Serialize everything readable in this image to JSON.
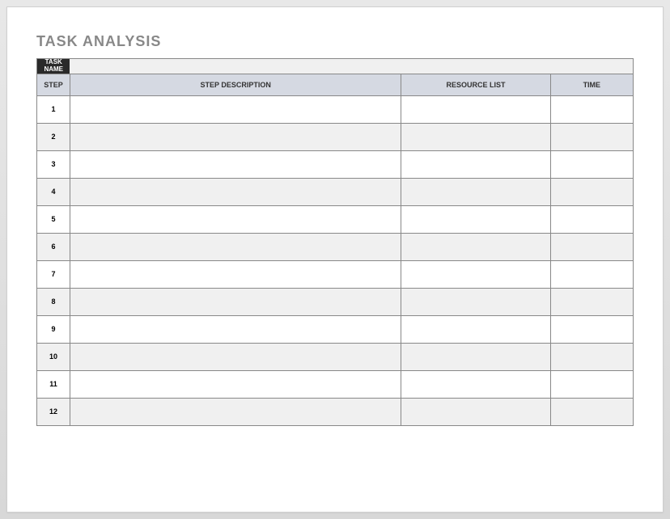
{
  "title": "TASK ANALYSIS",
  "taskNameLine1": "TASK",
  "taskNameLine2": "NAME",
  "headers": {
    "step": "STEP",
    "description": "STEP DESCRIPTION",
    "resource": "RESOURCE LIST",
    "time": "TIME"
  },
  "rows": [
    {
      "step": "1",
      "description": "",
      "resource": "",
      "time": ""
    },
    {
      "step": "2",
      "description": "",
      "resource": "",
      "time": ""
    },
    {
      "step": "3",
      "description": "",
      "resource": "",
      "time": ""
    },
    {
      "step": "4",
      "description": "",
      "resource": "",
      "time": ""
    },
    {
      "step": "5",
      "description": "",
      "resource": "",
      "time": ""
    },
    {
      "step": "6",
      "description": "",
      "resource": "",
      "time": ""
    },
    {
      "step": "7",
      "description": "",
      "resource": "",
      "time": ""
    },
    {
      "step": "8",
      "description": "",
      "resource": "",
      "time": ""
    },
    {
      "step": "9",
      "description": "",
      "resource": "",
      "time": ""
    },
    {
      "step": "10",
      "description": "",
      "resource": "",
      "time": ""
    },
    {
      "step": "11",
      "description": "",
      "resource": "",
      "time": ""
    },
    {
      "step": "12",
      "description": "",
      "resource": "",
      "time": ""
    }
  ]
}
